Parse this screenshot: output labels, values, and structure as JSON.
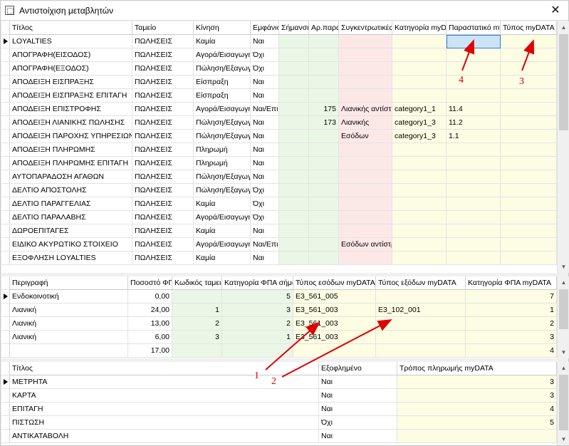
{
  "window": {
    "title": "Αντιστοίχιση μεταβλητών",
    "close_glyph": "✕"
  },
  "colors": {
    "green": "#eaf7e6",
    "pink": "#fde8e8",
    "yellow": "#fdfde4",
    "annotation": "#e00000"
  },
  "top": {
    "headers": [
      "Τίτλος",
      "Ταμείο",
      "Κίνηση",
      "Εμφάνιση",
      "Σήμανση",
      "Αρ.παραστατικού",
      "Συγκεντρωτικές",
      "Κατηγορία myDATA",
      "Παραστατικό myDATA",
      "Τύπος myDATA"
    ],
    "rows": [
      [
        "LOYALTIES",
        "ΠΩΛΗΣΕΙΣ",
        "Καμία",
        "Ναι",
        "",
        "",
        "",
        "",
        "",
        ""
      ],
      [
        "ΑΠΟΓΡΑΦΗ(ΕΙΣΟΔΟΣ)",
        "ΠΩΛΗΣΕΙΣ",
        "Αγορά/Εισαγωγή",
        "Όχι",
        "",
        "",
        "",
        "",
        "",
        ""
      ],
      [
        "ΑΠΟΓΡΑΦΗ(ΕΞΟΔΟΣ)",
        "ΠΩΛΗΣΕΙΣ",
        "Πώληση/Εξαγωγή",
        "Όχι",
        "",
        "",
        "",
        "",
        "",
        ""
      ],
      [
        "ΑΠΟΔΕΙΞΗ ΕΙΣΠΡΑΞΗΣ",
        "ΠΩΛΗΣΕΙΣ",
        "Είσπραξη",
        "Ναι",
        "",
        "",
        "",
        "",
        "",
        ""
      ],
      [
        "ΑΠΟΔΕΙΞΗ ΕΙΣΠΡΑΞΗΣ ΕΠΙΤΑΓΗ",
        "ΠΩΛΗΣΕΙΣ",
        "Είσπραξη",
        "Ναι",
        "",
        "",
        "",
        "",
        "",
        ""
      ],
      [
        "ΑΠΟΔΕΙΞΗ ΕΠΙΣΤΡΟΦΗΣ",
        "ΠΩΛΗΣΕΙΣ",
        "Αγορά/Εισαγωγή",
        "Ναι/Επιστροφή",
        "",
        "175",
        "Λιανικής αντίστροφη",
        "category1_1",
        "11.4",
        ""
      ],
      [
        "ΑΠΟΔΕΙΞΗ ΛΙΑΝΙΚΗΣ ΠΩΛΗΣΗΣ",
        "ΠΩΛΗΣΕΙΣ",
        "Πώληση/Εξαγωγή",
        "Ναι",
        "",
        "173",
        "Λιανικής",
        "category1_3",
        "11.2",
        ""
      ],
      [
        "ΑΠΟΔΕΙΞΗ ΠΑΡΟΧΗΣ ΥΠΗΡΕΣΙΩΝ",
        "ΠΩΛΗΣΕΙΣ",
        "Πώληση/Εξαγωγή",
        "Ναι",
        "",
        "",
        "Εσόδων",
        "category1_3",
        "1.1",
        ""
      ],
      [
        "ΑΠΟΔΕΙΞΗ ΠΛΗΡΩΜΗΣ",
        "ΠΩΛΗΣΕΙΣ",
        "Πληρωμή",
        "Ναι",
        "",
        "",
        "",
        "",
        "",
        ""
      ],
      [
        "ΑΠΟΔΕΙΞΗ ΠΛΗΡΩΜΗΣ ΕΠΙΤΑΓΗ",
        "ΠΩΛΗΣΕΙΣ",
        "Πληρωμή",
        "Ναι",
        "",
        "",
        "",
        "",
        "",
        ""
      ],
      [
        "ΑΥΤΟΠΑΡΑΔΟΣΗ ΑΓΑΘΩΝ",
        "ΠΩΛΗΣΕΙΣ",
        "Πώληση/Εξαγωγή",
        "Ναι",
        "",
        "",
        "",
        "",
        "",
        ""
      ],
      [
        "ΔΕΛΤΙΟ ΑΠΟΣΤΟΛΗΣ",
        "ΠΩΛΗΣΕΙΣ",
        "Πώληση/Εξαγωγή",
        "Όχι",
        "",
        "",
        "",
        "",
        "",
        ""
      ],
      [
        "ΔΕΛΤΙΟ ΠΑΡΑΓΓΕΛΙΑΣ",
        "ΠΩΛΗΣΕΙΣ",
        "Καμία",
        "Όχι",
        "",
        "",
        "",
        "",
        "",
        ""
      ],
      [
        "ΔΕΛΤΙΟ ΠΑΡΑΛΑΒΗΣ",
        "ΠΩΛΗΣΕΙΣ",
        "Αγορά/Εισαγωγή",
        "Όχι",
        "",
        "",
        "",
        "",
        "",
        ""
      ],
      [
        "ΔΩΡΟΕΠΙΤΑΓΕΣ",
        "ΠΩΛΗΣΕΙΣ",
        "Καμία",
        "Ναι",
        "",
        "",
        "",
        "",
        "",
        ""
      ],
      [
        "ΕΙΔΙΚΟ ΑΚΥΡΩΤΙΚΟ ΣΤΟΙΧΕΙΟ",
        "ΠΩΛΗΣΕΙΣ",
        "Αγορά/Εισαγωγή",
        "Ναι/Επιστροφή",
        "",
        "",
        "Εσόδων αντίστροφη",
        "",
        "",
        ""
      ],
      [
        "ΕΞΟΦΛΗΣΗ LOYALTIES",
        "ΠΩΛΗΣΕΙΣ",
        "Καμία",
        "Ναι",
        "",
        "",
        "",
        "",
        "",
        ""
      ]
    ]
  },
  "mid": {
    "headers": [
      "Περιγραφή",
      "Ποσοστό ΦΠΑ",
      "Κωδικός ταμειακής",
      "Κατηγορία ΦΠΑ σήμανσης",
      "Τύπος εσόδων myDATA",
      "Τύπος εξόδων myDATA",
      "Κατηγορία ΦΠΑ myDATA"
    ],
    "rows": [
      [
        "Ενδοκοινοτική",
        "0,00",
        "",
        "5",
        "E3_561_005",
        "",
        "7"
      ],
      [
        "Λιανική",
        "24,00",
        "1",
        "3",
        "E3_561_003",
        "E3_102_001",
        "1"
      ],
      [
        "Λιανική",
        "13,00",
        "2",
        "2",
        "E3_561_003",
        "",
        "2"
      ],
      [
        "Λιανική",
        "6,00",
        "3",
        "1",
        "E3_561_003",
        "",
        "3"
      ],
      [
        "",
        "17,00",
        "",
        "",
        "",
        "",
        "4"
      ]
    ]
  },
  "bottom": {
    "headers": [
      "Τίτλος",
      "Εξοφλημένο",
      "Τρόπος πληρωμής myDATA"
    ],
    "rows": [
      [
        "ΜΕΤΡΗΤΑ",
        "Ναι",
        "3"
      ],
      [
        "ΚΑΡΤΑ",
        "Ναι",
        "3"
      ],
      [
        "ΕΠΙΤΑΓΗ",
        "Ναι",
        "4"
      ],
      [
        "ΠΙΣΤΩΣΗ",
        "Όχι",
        "5"
      ],
      [
        "ΑΝΤΙΚΑΤΑΒΟΛΗ",
        "Ναι",
        ""
      ]
    ]
  },
  "annotations": [
    "1",
    "2",
    "3",
    "4"
  ]
}
